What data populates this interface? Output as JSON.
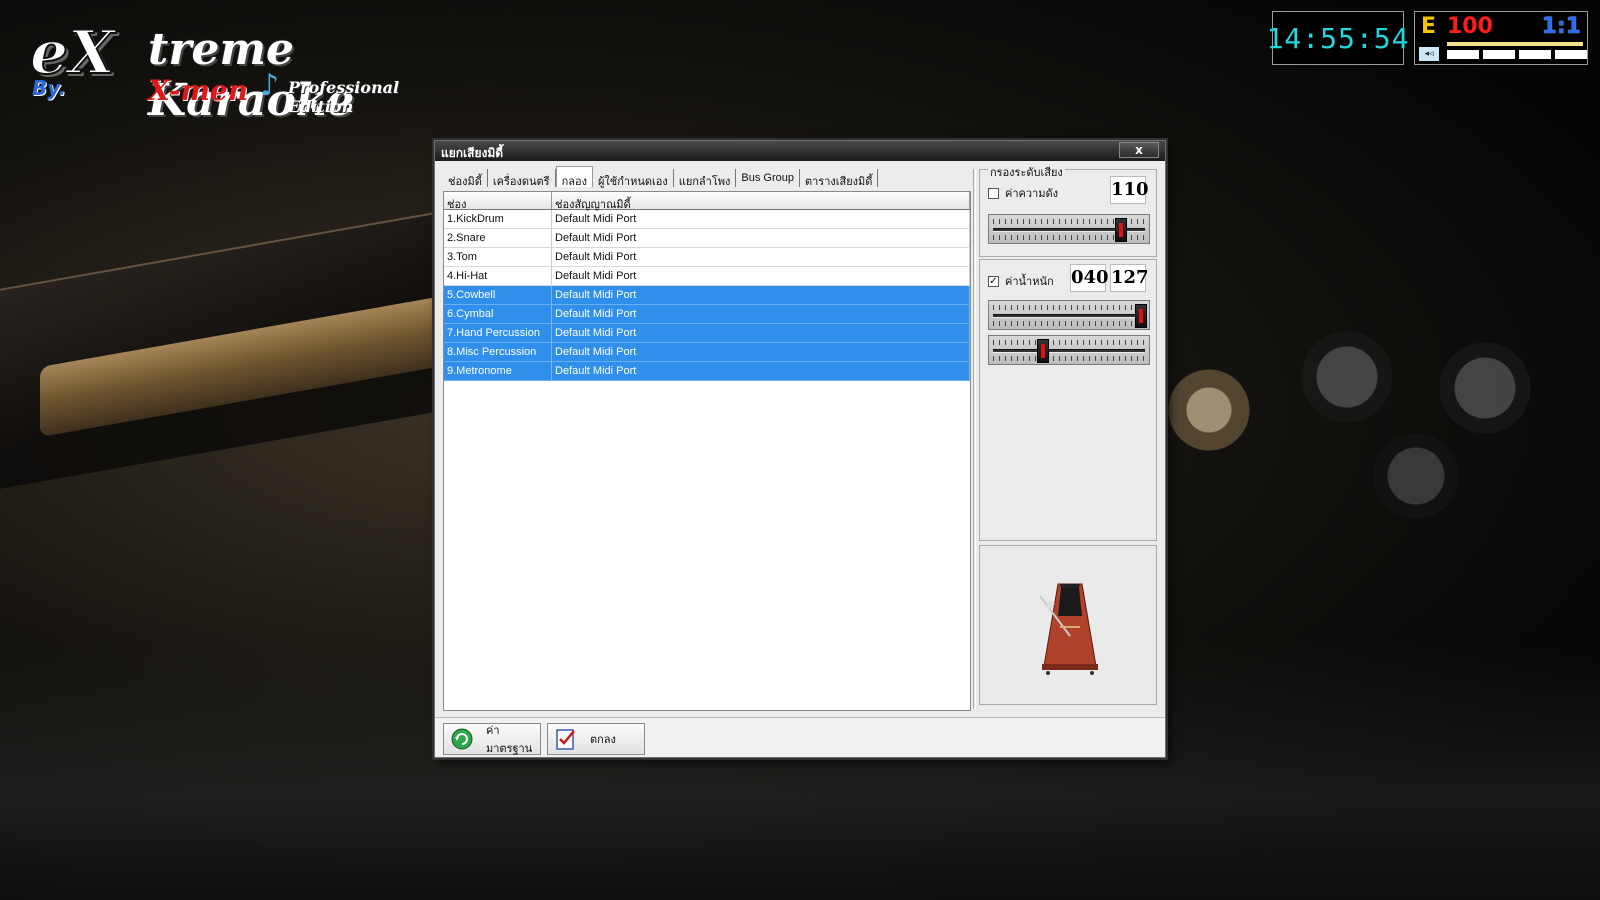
{
  "logo": {
    "brand_ex": "eX",
    "brand_rest": "treme Karaoke",
    "by": "By.",
    "men": "X-men",
    "edition": "Professional Edition"
  },
  "clock": "14:55:54",
  "status": {
    "mode": "E",
    "count": "100",
    "ratio": "1:1"
  },
  "dialog": {
    "title": "แยกเสียงมิดี้",
    "close_label": "x",
    "tabs": [
      {
        "label": "ช่องมิดี้",
        "active": false
      },
      {
        "label": "เครื่องดนตรี",
        "active": false
      },
      {
        "label": "กลอง",
        "active": true
      },
      {
        "label": "ผู้ใช้กำหนดเอง",
        "active": false
      },
      {
        "label": "แยกลำโพง",
        "active": false
      },
      {
        "label": "Bus Group",
        "active": false
      },
      {
        "label": "ตารางเสียงมิดี้",
        "active": false
      }
    ],
    "table": {
      "headers": [
        "ช่อง",
        "ช่องสัญญาณมิดี้"
      ],
      "rows": [
        {
          "channel": "1.KickDrum",
          "port": "Default Midi Port",
          "selected": false
        },
        {
          "channel": "2.Snare",
          "port": "Default Midi Port",
          "selected": false
        },
        {
          "channel": "3.Tom",
          "port": "Default Midi Port",
          "selected": false
        },
        {
          "channel": "4.Hi-Hat",
          "port": "Default Midi Port",
          "selected": false
        },
        {
          "channel": "5.Cowbell",
          "port": "Default Midi Port",
          "selected": true
        },
        {
          "channel": "6.Cymbal",
          "port": "Default Midi Port",
          "selected": true
        },
        {
          "channel": "7.Hand Percussion",
          "port": "Default Midi Port",
          "selected": true
        },
        {
          "channel": "8.Misc Percussion",
          "port": "Default Midi Port",
          "selected": true
        },
        {
          "channel": "9.Metronome",
          "port": "Default Midi Port",
          "selected": true
        }
      ]
    },
    "filter": {
      "legend": "กรองระดับเสียง",
      "volume": {
        "label": "ค่าความดัง",
        "checked": false,
        "value": "110",
        "slider_level": 0.86
      },
      "velocity": {
        "label": "ค่าน้ำหนัก",
        "checked": true,
        "min_value": "040",
        "max_value": "127",
        "slider_max_level": 1.0,
        "slider_min_level": 0.31
      }
    },
    "buttons": {
      "default_label": "ค่ามาตรฐาน",
      "ok_label": "ตกลง"
    }
  }
}
